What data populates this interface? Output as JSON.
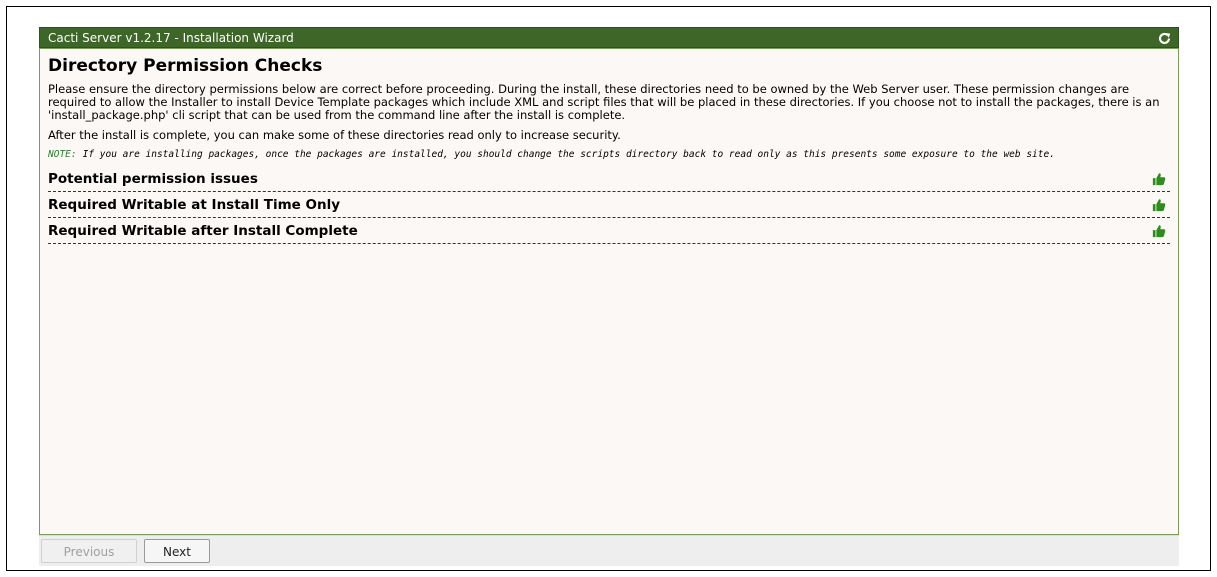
{
  "window": {
    "title": "Cacti Server v1.2.17 - Installation Wizard",
    "refresh_icon": "refresh-icon"
  },
  "main": {
    "heading": "Directory Permission Checks",
    "intro": "Please ensure the directory permissions below are correct before proceeding. During the install, these directories need to be owned by the Web Server user. These permission changes are required to allow the Installer to install Device Template packages which include XML and script files that will be placed in these directories. If you choose not to install the packages, there is an 'install_package.php' cli script that can be used from the command line after the install is complete.",
    "after_install": "After the install is complete, you can make some of these directories read only to increase security.",
    "note_label": "NOTE:",
    "note_text": "If you are installing packages, once the packages are installed, you should change the scripts directory back to read only as this presents some exposure to the web site.",
    "sections": [
      {
        "label": "Potential permission issues",
        "status_icon": "thumbs-up-icon"
      },
      {
        "label": "Required Writable at Install Time Only",
        "status_icon": "thumbs-up-icon"
      },
      {
        "label": "Required Writable after Install Complete",
        "status_icon": "thumbs-up-icon"
      }
    ]
  },
  "footer": {
    "previous_label": "Previous",
    "next_label": "Next"
  },
  "colors": {
    "titlebar": "#3f6629",
    "status_ok": "#2e8b1e",
    "note_label": "#2e7d32"
  }
}
